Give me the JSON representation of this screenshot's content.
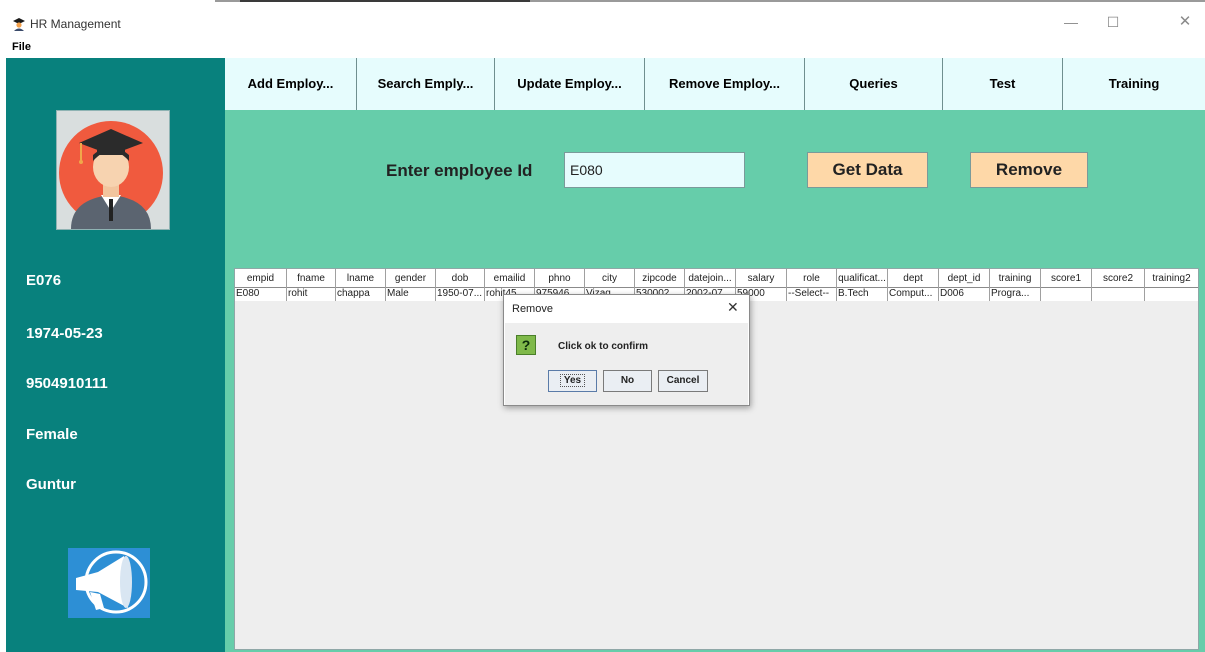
{
  "window": {
    "title": "HR Management",
    "controls": {
      "minimize": "—",
      "maximize": "☐",
      "close": "✕"
    }
  },
  "menu": {
    "file": "File"
  },
  "sidebar": {
    "employee_id": "E076",
    "dob": "1974-05-23",
    "phone": "9504910111",
    "gender": "Female",
    "city": "Guntur"
  },
  "nav": {
    "tabs": [
      "Add Employ...",
      "Search Emply...",
      "Update Employ...",
      "Remove Employ...",
      "Queries",
      "Test",
      "Training"
    ]
  },
  "form": {
    "label": "Enter employee Id",
    "employee_id_value": "E080",
    "get_data_label": "Get Data",
    "remove_label": "Remove"
  },
  "table": {
    "columns": [
      "empid",
      "fname",
      "lname",
      "gender",
      "dob",
      "emailid",
      "phno",
      "city",
      "zipcode",
      "datejoin...",
      "salary",
      "role",
      "qualificat...",
      "dept",
      "dept_id",
      "training",
      "score1",
      "score2",
      "training2"
    ],
    "row": [
      "E080",
      "rohit",
      "chappa",
      "Male",
      "1950-07...",
      "rohit45...",
      "975946...",
      "Vizag",
      "530002",
      "2002-07...",
      "59000",
      "--Select--",
      "B.Tech",
      "Comput...",
      "D006",
      "Progra...",
      "",
      "",
      ""
    ]
  },
  "dialog": {
    "title": "Remove",
    "close": "✕",
    "message": "Click ok to confirm",
    "icon": "?",
    "yes": "Yes",
    "no": "No",
    "cancel": "Cancel"
  },
  "colors": {
    "sidebar": "#08817d",
    "main": "#66cdaa",
    "nav": "#e6fcfd",
    "button": "#fed8a8"
  }
}
